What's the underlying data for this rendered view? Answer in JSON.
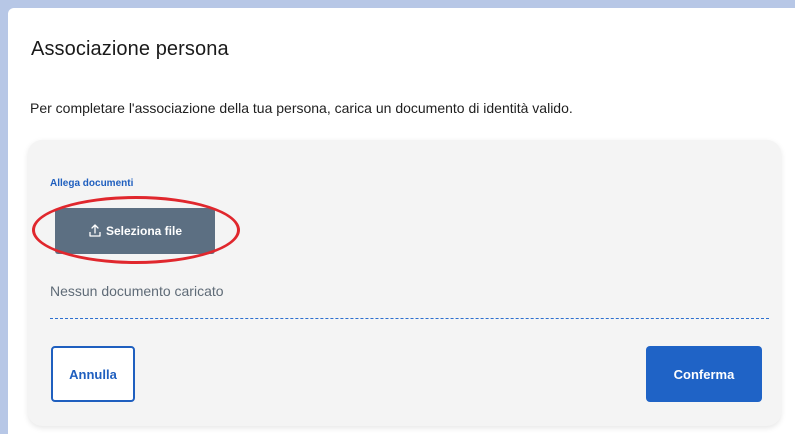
{
  "modal": {
    "title": "Associazione persona",
    "description": "Per completare l'associazione della tua persona, carica un documento di identità valido."
  },
  "upload": {
    "attach_label": "Allega documenti",
    "select_file_label": "Seleziona file",
    "upload_icon": "upload-icon",
    "empty_state": "Nessun documento caricato"
  },
  "actions": {
    "cancel_label": "Annulla",
    "confirm_label": "Conferma"
  },
  "colors": {
    "background": "#b7c7e6",
    "primary": "#1f63c6",
    "secondary_button": "#5c6f82",
    "highlight": "#e0272d"
  }
}
